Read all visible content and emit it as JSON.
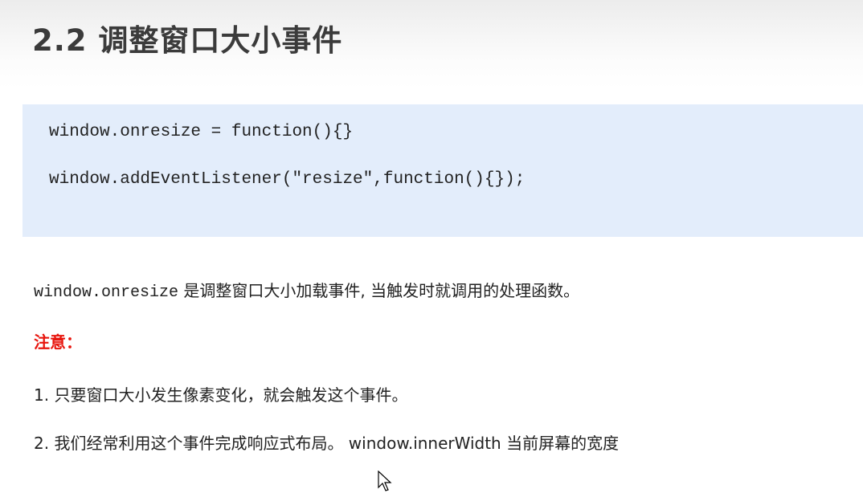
{
  "title": "2.2 调整窗口大小事件",
  "code": [
    "window.onresize = function(){}",
    "window.addEventListener(\"resize\",function(){});"
  ],
  "description": {
    "code": "window.onresize",
    "text": " 是调整窗口大小加载事件, 当触发时就调用的处理函数。"
  },
  "note_label": "注意：",
  "notes": [
    "1. 只要窗口大小发生像素变化，就会触发这个事件。",
    "2. 我们经常利用这个事件完成响应式布局。 window.innerWidth 当前屏幕的宽度"
  ],
  "colors": {
    "code_bg": "#e3edfb",
    "warn": "#e8150d"
  }
}
